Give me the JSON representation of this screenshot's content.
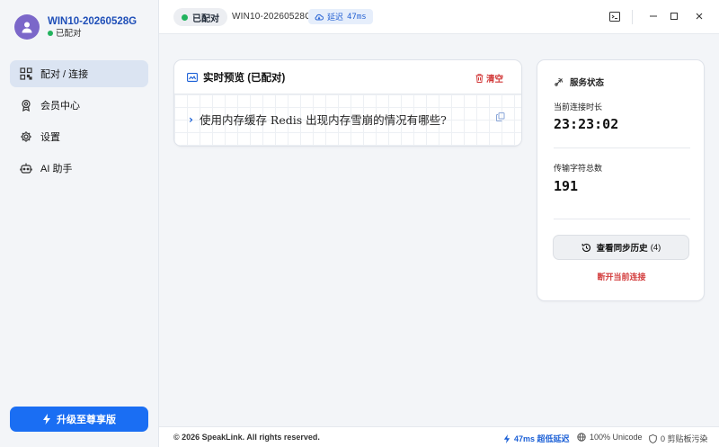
{
  "profile": {
    "name": "WIN10-20260528G",
    "status": "已配对",
    "status_color": "#22b35e"
  },
  "sidebar": {
    "items": [
      {
        "label": "配对 / 连接",
        "icon": "qr-code-icon",
        "active": true
      },
      {
        "label": "会员中心",
        "icon": "badge-icon"
      },
      {
        "label": "设置",
        "icon": "gear-icon"
      },
      {
        "label": "AI 助手",
        "icon": "robot-icon"
      }
    ],
    "upgrade_label": "升级至尊享版"
  },
  "topbar": {
    "pair_status": "已配对",
    "device_id": "WIN10-20260528G",
    "latency_label": "延迟",
    "latency_value": "47ms"
  },
  "preview": {
    "title": "实时预览 (已配对)",
    "clear_label": "清空",
    "line_text": "使用内存缓存 Redis 出现内存雪崩的情况有哪些?"
  },
  "status_panel": {
    "title": "服务状态",
    "duration_label": "当前连接时长",
    "duration_value": "23:23:02",
    "chars_label": "传输字符总数",
    "chars_value": "191",
    "history_label": "查看同步历史",
    "history_count": "(4)",
    "disconnect_label": "断开当前连接"
  },
  "footer": {
    "copyright": "© 2026 SpeakLink. All rights reserved.",
    "latency": "47ms 超低延迟",
    "unicode": "100% Unicode",
    "clipboard": "0 剪贴板污染"
  },
  "colors": {
    "accent": "#1a6ef3",
    "danger": "#d23a3a",
    "brand_name": "#1f4fb8"
  }
}
